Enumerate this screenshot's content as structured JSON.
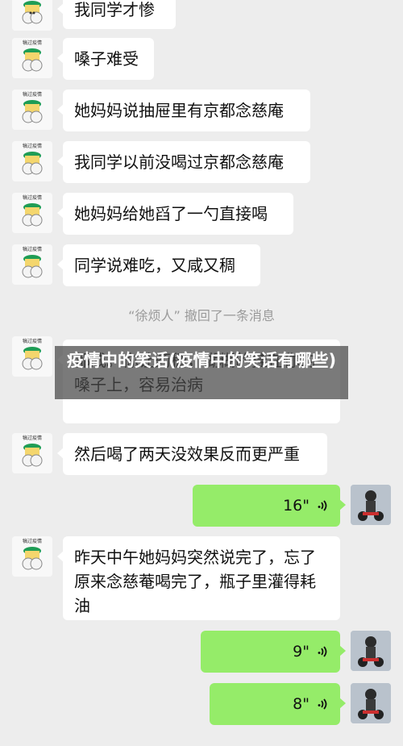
{
  "overlay_title": "疫情中的笑话(疫情中的笑话有哪些)",
  "system_notice": "“徐烦人” 撤回了一条消息",
  "avatar_left_caption": "犒过疫情",
  "messages": [
    {
      "side": "left",
      "text": "我同学才惨"
    },
    {
      "side": "left",
      "text": "嗓子难受"
    },
    {
      "side": "left",
      "text": "她妈妈说抽屉里有京都念慈庵"
    },
    {
      "side": "left",
      "text": "我同学以前没喝过京都念慈庵"
    },
    {
      "side": "left",
      "text": "她妈妈给她舀了一勺直接喝"
    },
    {
      "side": "left",
      "text": "同学说难吃，又咸又稠"
    },
    {
      "side": "left",
      "text": "都咸。你让药稠，糊糊的挂在你的嗓子上，容易治病"
    },
    {
      "side": "left",
      "text": "然后喝了两天没效果反而更严重"
    },
    {
      "side": "right",
      "duration": "16\""
    },
    {
      "side": "left",
      "text": "昨天中午她妈妈突然说完了，忘了原来念慈菴喝完了，瓶子里灌得耗油"
    },
    {
      "side": "right",
      "duration": "9\""
    },
    {
      "side": "right",
      "duration": "8\""
    }
  ],
  "icons": {
    "left_avatar": "cartoon-mascot-avatar",
    "right_avatar": "motorcycle-rider-avatar",
    "voice": "voice-wave-icon"
  },
  "colors": {
    "background": "#ededed",
    "bubble_left": "#ffffff",
    "bubble_right": "#95ec69",
    "system_text": "#9a9a9a",
    "overlay_bg": "#464646"
  }
}
